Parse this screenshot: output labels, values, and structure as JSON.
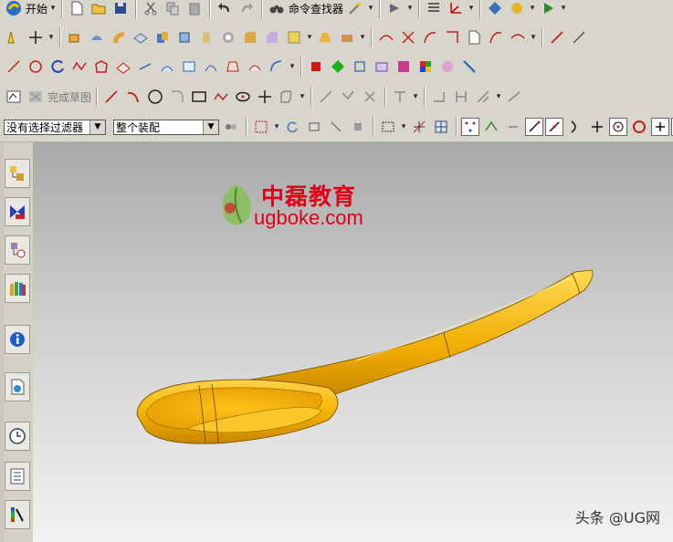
{
  "toolbar1": {
    "start_label": "开始",
    "command_finder_label": "命令查找器"
  },
  "toolbar4": {
    "finish_sketch_label": "完成草图"
  },
  "selection_bar": {
    "filter_value": "没有选择过滤器",
    "assembly_scope_value": "整个装配"
  },
  "watermark": {
    "title": "中磊教育",
    "url": "ugboke.com"
  },
  "credit": "头条 @UG网",
  "colors": {
    "part_gold": "#f5b400",
    "part_shadow": "#c48400",
    "watermark_red": "#e0001a",
    "toolbar_bg": "#d8d5cc"
  }
}
